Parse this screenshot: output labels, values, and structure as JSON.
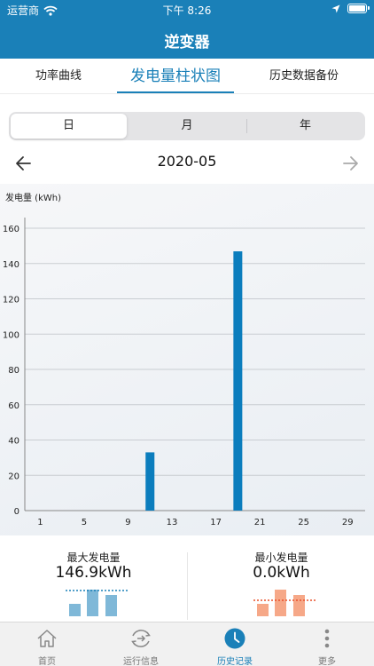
{
  "status_bar": {
    "carrier": "运营商",
    "time": "下午 8:26"
  },
  "nav": {
    "title": "逆变器"
  },
  "tabs": [
    {
      "label": "功率曲线",
      "active": false
    },
    {
      "label": "发电量柱状图",
      "active": true
    },
    {
      "label": "历史数据备份",
      "active": false
    }
  ],
  "segment": [
    {
      "label": "日",
      "active": true
    },
    {
      "label": "月",
      "active": false
    },
    {
      "label": "年",
      "active": false
    }
  ],
  "date_nav": {
    "current": "2020-05",
    "prev_icon": "arrow-left-icon",
    "next_icon": "arrow-right-icon"
  },
  "chart_data": {
    "type": "bar",
    "ylabel": "发电量 (kWh)",
    "ylim": [
      0,
      160
    ],
    "yticks": [
      0,
      20,
      40,
      60,
      80,
      100,
      120,
      140,
      160
    ],
    "xlim": [
      0,
      31
    ],
    "xticks": [
      1,
      5,
      9,
      13,
      17,
      21,
      25,
      29
    ],
    "grid": true,
    "bar_color": "#0b7dbd",
    "bars": [
      {
        "day": 11,
        "value": 33.0
      },
      {
        "day": 19,
        "value": 146.9
      }
    ]
  },
  "stats": {
    "max": {
      "title": "最大发电量",
      "value": "146.9kWh",
      "color": "#7fb8d8",
      "line_color": "#1a80b8"
    },
    "min": {
      "title": "最小发电量",
      "value": "0.0kWh",
      "color": "#f6a888",
      "line_color": "#e8502a"
    }
  },
  "tabbar": [
    {
      "label": "首页",
      "icon": "home-icon",
      "active": false
    },
    {
      "label": "运行信息",
      "icon": "run-info-icon",
      "active": false
    },
    {
      "label": "历史记录",
      "icon": "history-clock-icon",
      "active": true
    },
    {
      "label": "更多",
      "icon": "more-icon",
      "active": false
    }
  ],
  "colors": {
    "primary": "#1a80b8",
    "accent": "#0b7dbd"
  }
}
